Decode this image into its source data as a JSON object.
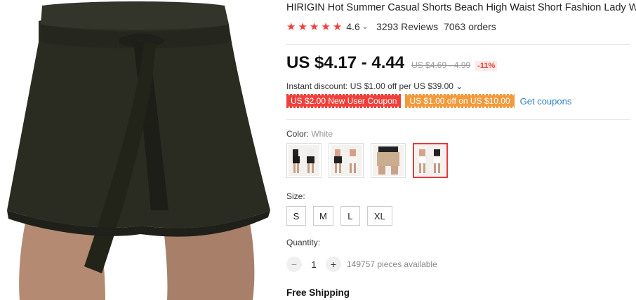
{
  "product": {
    "title": "HIRIGIN Hot Summer Casual Shorts Beach High Waist Short Fashion Lady Women",
    "rating": "4.6",
    "rating_caret": "⌄",
    "reviews": "3293 Reviews",
    "orders": "7063 orders",
    "stars": 5
  },
  "price": {
    "current": "US $4.17 - 4.44",
    "original": "US $4.69 - 4.99",
    "discount": "-11%"
  },
  "discounts": {
    "instant": "Instant discount: US $1.00 off per US $39.00 ⌄",
    "coupon_1": "US $2.00 New User Coupon",
    "coupon_2": "US $1.00 off on US $10.00",
    "get_coupons": "Get coupons"
  },
  "color": {
    "label": "Color: ",
    "value": "White",
    "swatch_count": 4,
    "selected_index": 3
  },
  "size": {
    "label": "Size:",
    "options": [
      "S",
      "M",
      "L",
      "XL"
    ]
  },
  "quantity": {
    "label": "Quantity:",
    "minus": "−",
    "plus": "+",
    "value": "1",
    "available": "149757 pieces available"
  },
  "shipping": {
    "label": "Free Shipping"
  },
  "colors": {
    "accent_red": "#f0403b",
    "coupon_orange": "#f29a3c",
    "link_blue": "#2e7fbf"
  }
}
